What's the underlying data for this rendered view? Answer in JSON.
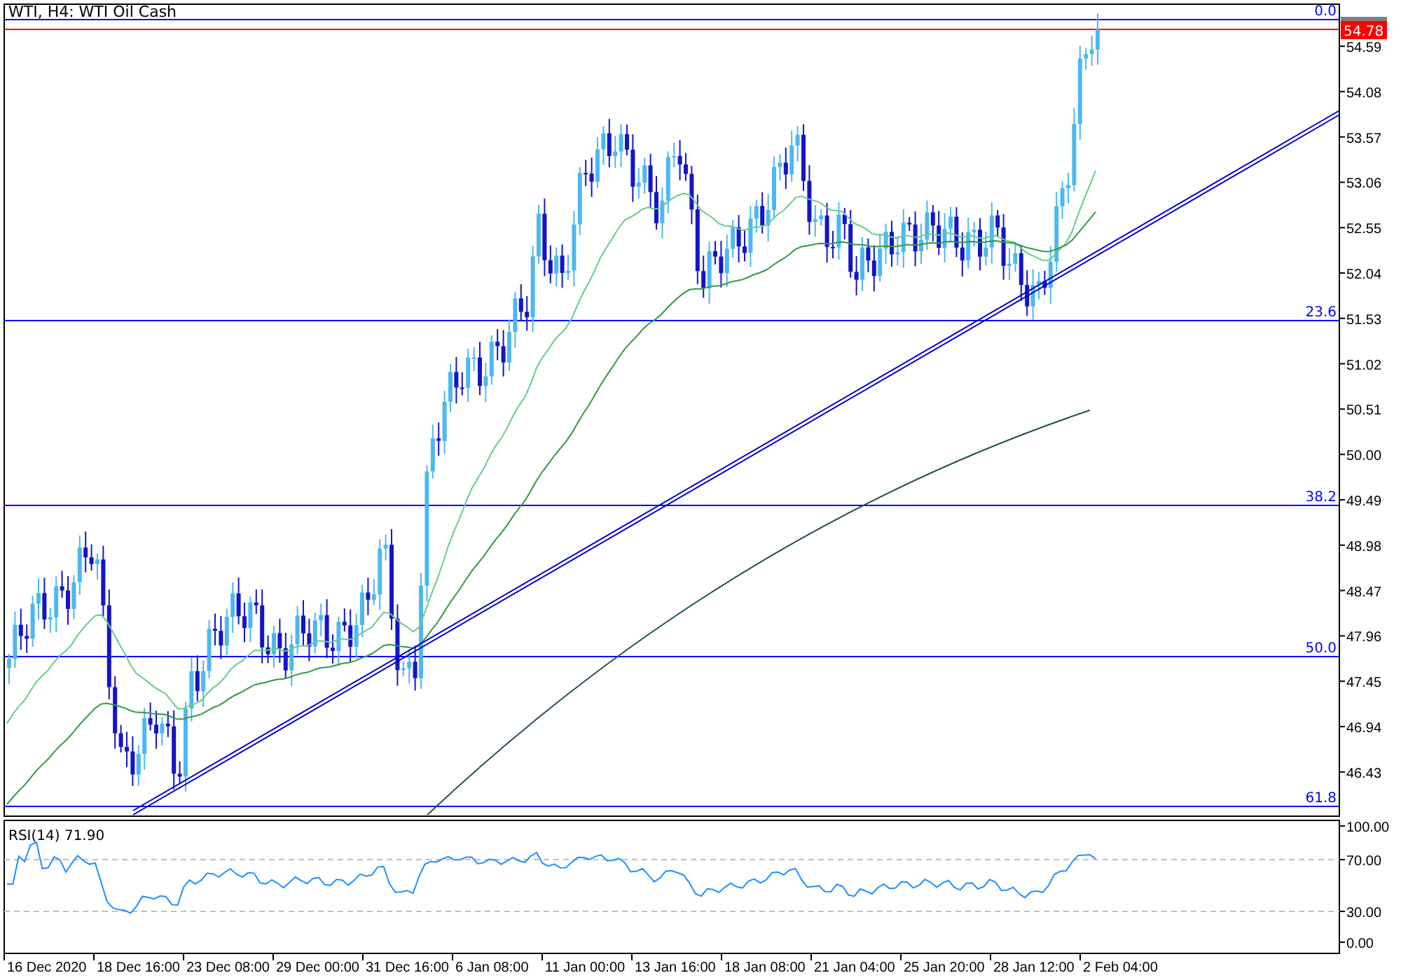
{
  "title": "WTI, H4:  WTI Oil Cash",
  "price_axis": [
    "54.59",
    "54.08",
    "53.57",
    "53.06",
    "52.55",
    "52.04",
    "51.53",
    "51.02",
    "50.51",
    "50.00",
    "49.49",
    "48.98",
    "48.47",
    "47.96",
    "47.45",
    "46.94",
    "46.43"
  ],
  "price_label": {
    "text": "54.78",
    "kind": "bid"
  },
  "fibonacci_levels": [
    {
      "label": "0.0"
    },
    {
      "label": "23.6"
    },
    {
      "label": "38.2"
    },
    {
      "label": "50.0"
    },
    {
      "label": "61.8"
    }
  ],
  "rsi": {
    "title": "RSI(14) 71.90",
    "ticks": [
      "100.00",
      "70.00",
      "30.00",
      "0.00"
    ]
  },
  "time_axis": [
    "16 Dec 2020",
    "18 Dec 16:00",
    "23 Dec 08:00",
    "29 Dec 00:00",
    "31 Dec 16:00",
    "6 Jan 08:00",
    "11 Jan 00:00",
    "13 Jan 16:00",
    "18 Jan 08:00",
    "21 Jan 04:00",
    "25 Jan 20:00",
    "28 Jan 12:00",
    "2 Feb 04:00"
  ]
}
